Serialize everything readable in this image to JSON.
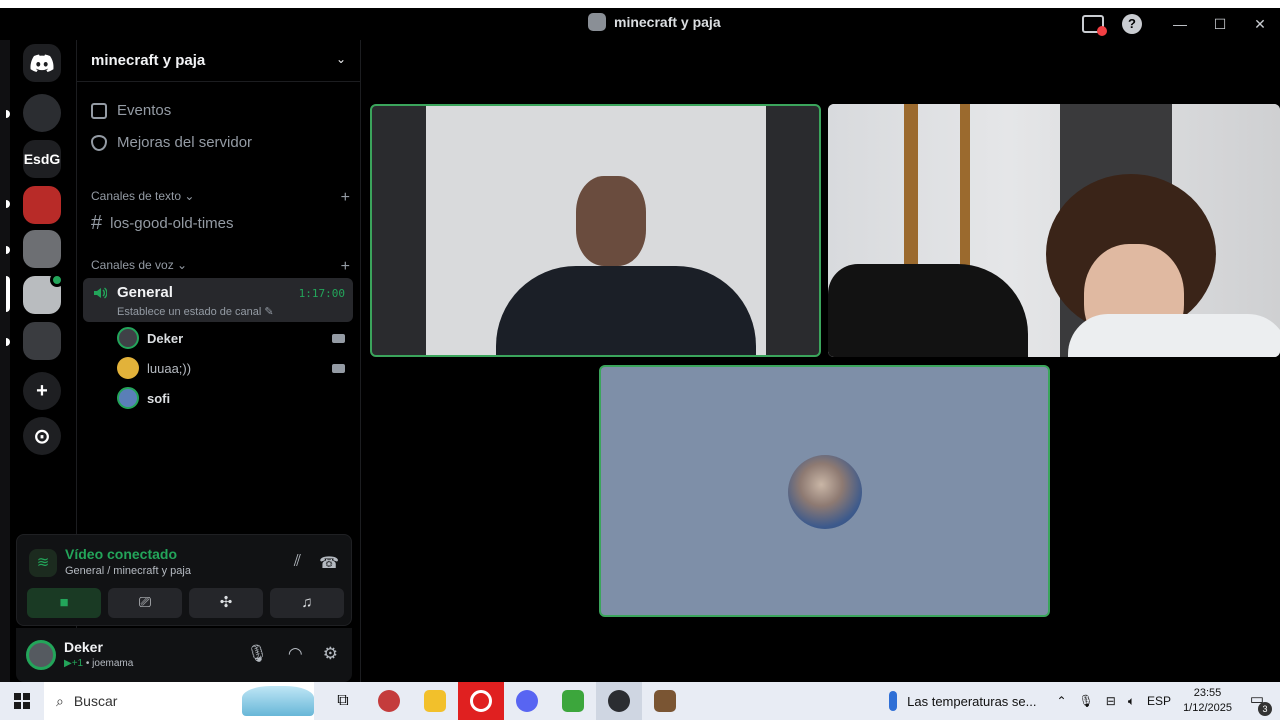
{
  "window": {
    "title": "minecraft y paja"
  },
  "rail": {
    "servers": [
      {
        "label": "",
        "icon": "discord-icon"
      },
      {
        "label": "",
        "icon": "server-icon"
      },
      {
        "label": "EsdG",
        "icon": ""
      },
      {
        "label": "",
        "icon": "server-icon"
      },
      {
        "label": "",
        "icon": "server-icon"
      },
      {
        "label": "",
        "icon": "server-icon"
      },
      {
        "label": "",
        "icon": "server-icon"
      }
    ]
  },
  "sidebar": {
    "server_name": "minecraft y paja",
    "events_label": "Eventos",
    "boosts_label": "Mejoras del servidor",
    "text_category": "Canales de texto",
    "text_channel": "los-good-old-times",
    "voice_category": "Canales de voz",
    "voice_channel": {
      "name": "General",
      "time": "1:17:00",
      "status": "Establece un estado de canal"
    },
    "members": [
      {
        "name": "Deker",
        "camera": true
      },
      {
        "name": "luuaa;))",
        "camera": true
      },
      {
        "name": "sofi",
        "camera": false
      }
    ]
  },
  "voice_panel": {
    "title": "Vídeo conectado",
    "subtitle": "General / minecraft y paja"
  },
  "user_panel": {
    "name": "Deker",
    "status_prefix": "+1",
    "status_text": "joemama"
  },
  "taskbar": {
    "search_placeholder": "Buscar",
    "weather": "Las temperaturas se...",
    "language": "ESP",
    "time": "23:55",
    "date": "1/12/2025",
    "notifications": "3"
  },
  "colors": {
    "speaking_border": "#3ba55c",
    "online_green": "#23a55a",
    "background": "#000000"
  }
}
